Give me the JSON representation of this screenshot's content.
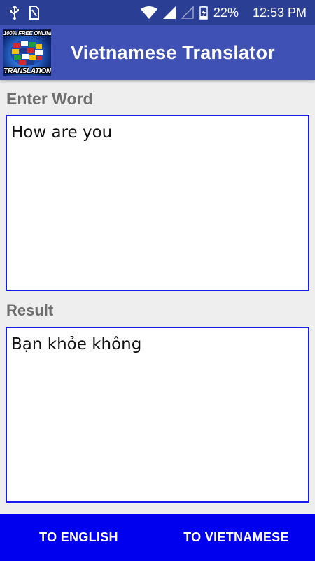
{
  "status_bar": {
    "battery": "22%",
    "time": "12:53 PM",
    "icons": [
      "usb-icon",
      "sim-icon",
      "wifi-icon",
      "signal-icon",
      "signal-empty-icon",
      "battery-charging-icon"
    ]
  },
  "app_bar": {
    "title": "Vietnamese Translator",
    "logo_top_text": "100% FREE ONLINE",
    "logo_bottom_text": "TRANSLATION"
  },
  "input": {
    "label": "Enter Word",
    "value": "How are you"
  },
  "result": {
    "label": "Result",
    "value": "Bạn khỏe không"
  },
  "buttons": {
    "to_english": "TO ENGLISH",
    "to_vietnamese": "TO VIETNAMESE"
  },
  "colors": {
    "status_bar": "#2a3f94",
    "app_bar": "#3f51b5",
    "textbox_border": "#1a1ae6",
    "bottom_bar": "#0000ee",
    "background": "#eeeeee"
  }
}
